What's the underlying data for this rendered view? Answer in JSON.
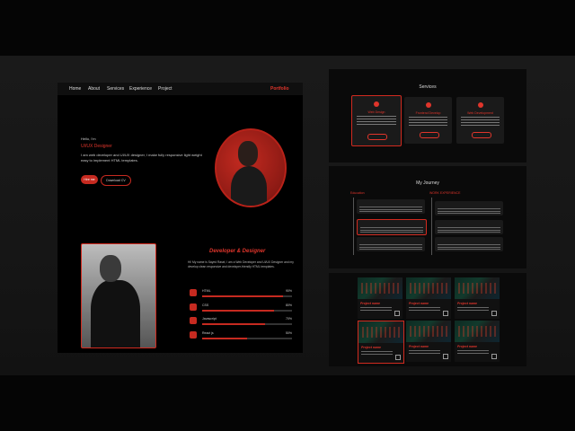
{
  "nav": {
    "items": [
      "Home",
      "About",
      "Services",
      "Experience",
      "Project"
    ],
    "brand": "Portfolio"
  },
  "hero": {
    "greeting": "Hello, I'm",
    "role": "UI/UX Designer",
    "description": "I am web developer and UI/UX designer, I make fully responsive light weight easy to implement HTML templates.",
    "hire_label": "Hire me",
    "cv_label": "Download CV"
  },
  "about": {
    "heading": "Developer & Designer",
    "paragraph": "Hi! My name is Sayed Rasel, I am a Web Developer and UI/UX Designer and my develop clean responsive and developer-friendly HTML templates."
  },
  "skills": [
    {
      "icon": "html5-icon",
      "label": "HTML",
      "pct_label": "90%",
      "fraction": 0.9
    },
    {
      "icon": "css3-icon",
      "label": "CSS",
      "pct_label": "80%",
      "fraction": 0.8
    },
    {
      "icon": "javascript-icon",
      "label": "Javascript",
      "pct_label": "70%",
      "fraction": 0.7
    },
    {
      "icon": "react-icon",
      "label": "React js",
      "pct_label": "50%",
      "fraction": 0.5
    }
  ],
  "services": {
    "title": "Services",
    "cards": [
      {
        "title": "Web Design",
        "button": "Read more"
      },
      {
        "title": "Frontend Develop",
        "button": "Read more"
      },
      {
        "title": "Web Development",
        "button": "Read more"
      }
    ]
  },
  "journey": {
    "title": "My Journey",
    "education_label": "Education",
    "work_label": "WORK EXPERIENCE"
  },
  "projects": {
    "title": "Project name",
    "count": 6
  },
  "colors": {
    "accent": "#e0352b",
    "background": "#000000",
    "card": "#1a1a1a"
  }
}
